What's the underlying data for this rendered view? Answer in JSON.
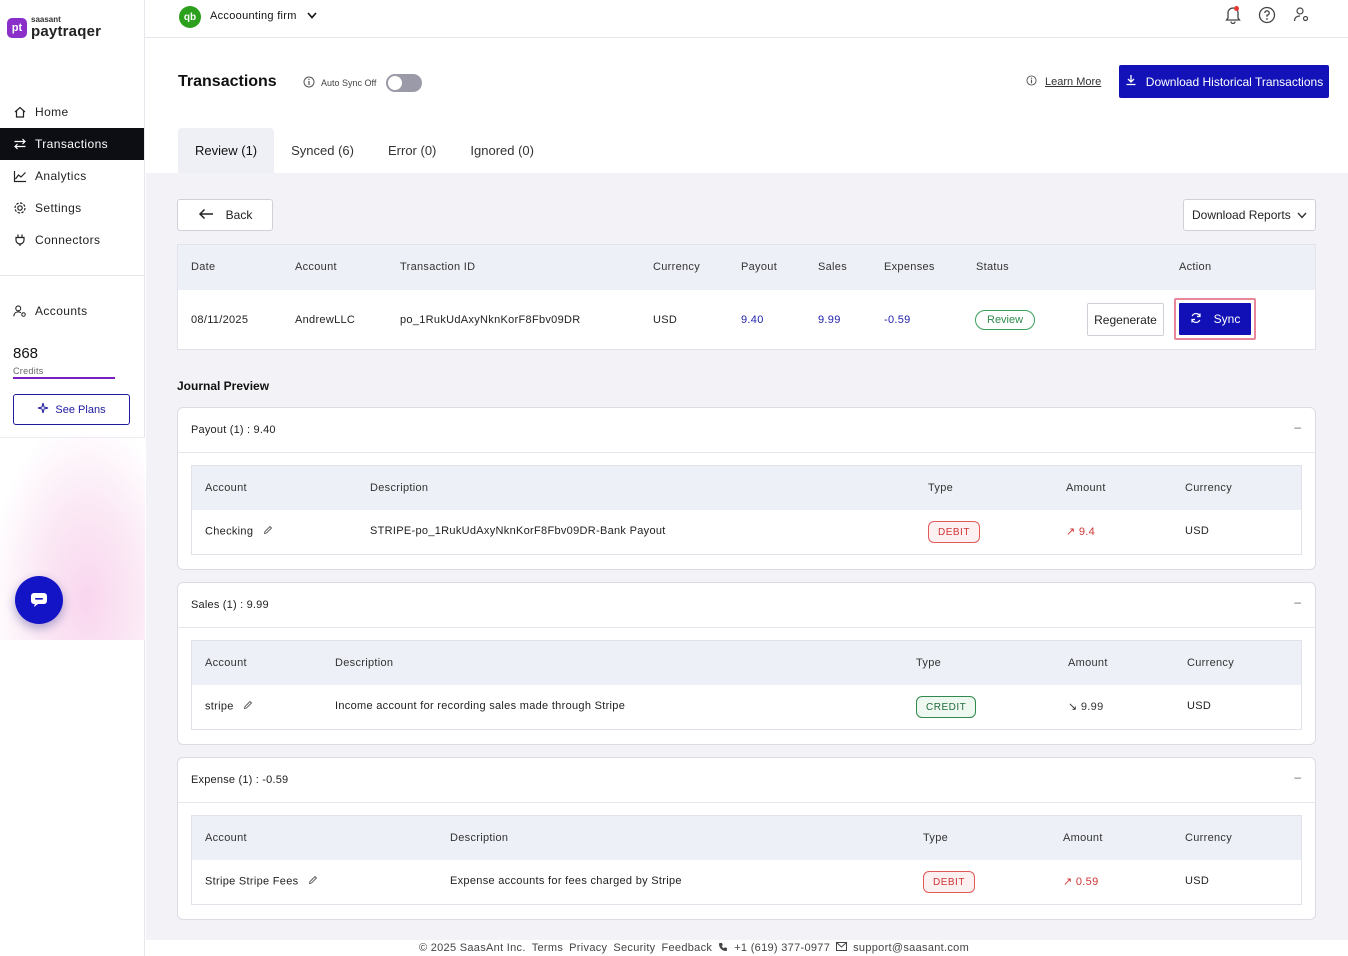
{
  "brand": {
    "logo_mark": "pt",
    "logo_small": "saasant",
    "logo_big": "paytraqer"
  },
  "sidebar": {
    "items": [
      {
        "label": "Home",
        "icon": "home-icon"
      },
      {
        "label": "Transactions",
        "icon": "transfer-icon",
        "active": true
      },
      {
        "label": "Analytics",
        "icon": "chart-line-icon"
      },
      {
        "label": "Settings",
        "icon": "gear-icon"
      },
      {
        "label": "Connectors",
        "icon": "plug-icon"
      }
    ],
    "accounts_label": "Accounts",
    "credits_value": "868",
    "credits_label": "Credits",
    "see_plans_label": "See Plans"
  },
  "topbar": {
    "qb_logo": "qb",
    "company_name": "Accoounting firm"
  },
  "header": {
    "title": "Transactions",
    "autosync_label": "Auto Sync Off",
    "learn_more": "Learn More",
    "download_historical": "Download Historical Transactions"
  },
  "tabs": [
    {
      "label": "Review (1)",
      "active": true
    },
    {
      "label": "Synced (6)"
    },
    {
      "label": "Error (0)"
    },
    {
      "label": "Ignored (0)"
    }
  ],
  "toolbar": {
    "back_label": "Back",
    "download_reports": "Download Reports"
  },
  "transactions": {
    "columns": [
      "Date",
      "Account",
      "Transaction ID",
      "Currency",
      "Payout",
      "Sales",
      "Expenses",
      "Status",
      "Action"
    ],
    "row": {
      "date": "08/11/2025",
      "account": "AndrewLLC",
      "transaction_id": "po_1RukUdAxyNknKorF8Fbv09DR",
      "currency": "USD",
      "payout": "9.40",
      "sales": "9.99",
      "expenses": "-0.59",
      "status": "Review",
      "regenerate": "Regenerate",
      "sync": "Sync"
    }
  },
  "journal": {
    "title": "Journal Preview",
    "sections": [
      {
        "title": "Payout (1) : 9.40",
        "columns": [
          "Account",
          "Description",
          "Type",
          "Amount",
          "Currency"
        ],
        "row": {
          "account": "Checking",
          "description": "STRIPE-po_1RukUdAxyNknKorF8Fbv09DR-Bank Payout",
          "type": "DEBIT",
          "amount": "9.4",
          "currency": "USD"
        }
      },
      {
        "title": "Sales (1) : 9.99",
        "columns": [
          "Account",
          "Description",
          "Type",
          "Amount",
          "Currency"
        ],
        "row": {
          "account": "stripe",
          "description": "Income account for recording sales made through Stripe",
          "type": "CREDIT",
          "amount": "9.99",
          "currency": "USD"
        }
      },
      {
        "title": "Expense (1) : -0.59",
        "columns": [
          "Account",
          "Description",
          "Type",
          "Amount",
          "Currency"
        ],
        "row": {
          "account": "Stripe Stripe Fees",
          "description": "Expense accounts for fees charged by Stripe",
          "type": "DEBIT",
          "amount": "0.59",
          "currency": "USD"
        }
      }
    ]
  },
  "footer": {
    "copyright": "© 2025 SaasAnt Inc.",
    "links": [
      "Terms",
      "Privacy",
      "Security",
      "Feedback"
    ],
    "phone": "+1 (619) 377-0977",
    "email": "support@saasant.com"
  },
  "colors": {
    "primary": "#1212b8",
    "active_nav": "#0d0d14",
    "debit": "#d03434",
    "credit": "#2f8a4c",
    "sync_highlight": "#e8869a"
  }
}
